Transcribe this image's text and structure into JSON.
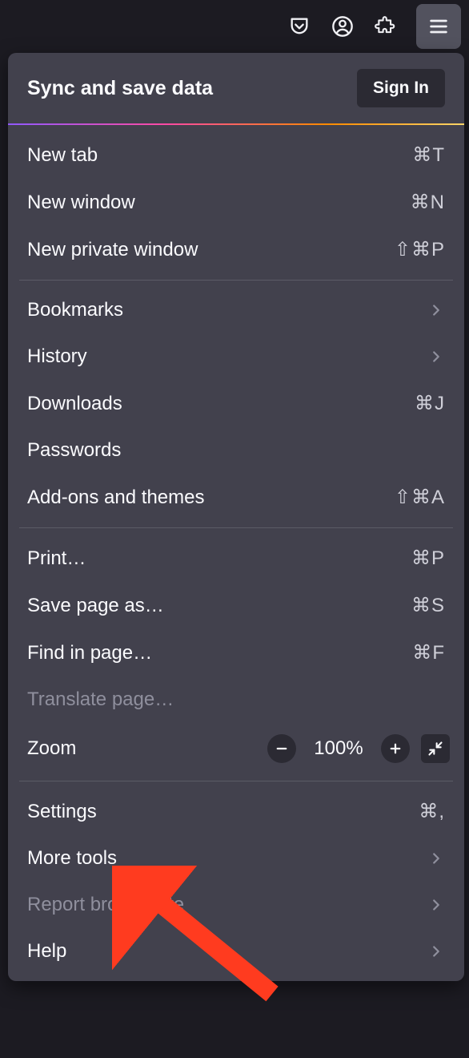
{
  "toolbar": {
    "icons": [
      "pocket",
      "account",
      "extensions",
      "menu"
    ]
  },
  "header": {
    "title": "Sync and save data",
    "sign_in_label": "Sign In"
  },
  "sections": [
    {
      "items": [
        {
          "label": "New tab",
          "shortcut": "⌘T"
        },
        {
          "label": "New window",
          "shortcut": "⌘N"
        },
        {
          "label": "New private window",
          "shortcut": "⇧⌘P"
        }
      ]
    },
    {
      "items": [
        {
          "label": "Bookmarks",
          "submenu": true
        },
        {
          "label": "History",
          "submenu": true
        },
        {
          "label": "Downloads",
          "shortcut": "⌘J"
        },
        {
          "label": "Passwords"
        },
        {
          "label": "Add-ons and themes",
          "shortcut": "⇧⌘A"
        }
      ]
    },
    {
      "items": [
        {
          "label": "Print…",
          "shortcut": "⌘P"
        },
        {
          "label": "Save page as…",
          "shortcut": "⌘S"
        },
        {
          "label": "Find in page…",
          "shortcut": "⌘F"
        },
        {
          "label": "Translate page…",
          "disabled": true
        }
      ]
    }
  ],
  "zoom": {
    "label": "Zoom",
    "value": "100%"
  },
  "footer_items": [
    {
      "label": "Settings",
      "shortcut": "⌘,"
    },
    {
      "label": "More tools",
      "submenu": true
    },
    {
      "label": "Report broken site",
      "submenu": true,
      "disabled": true
    },
    {
      "label": "Help",
      "submenu": true
    }
  ],
  "annotation": {
    "target": "Settings",
    "color": "#ff3b1f"
  }
}
